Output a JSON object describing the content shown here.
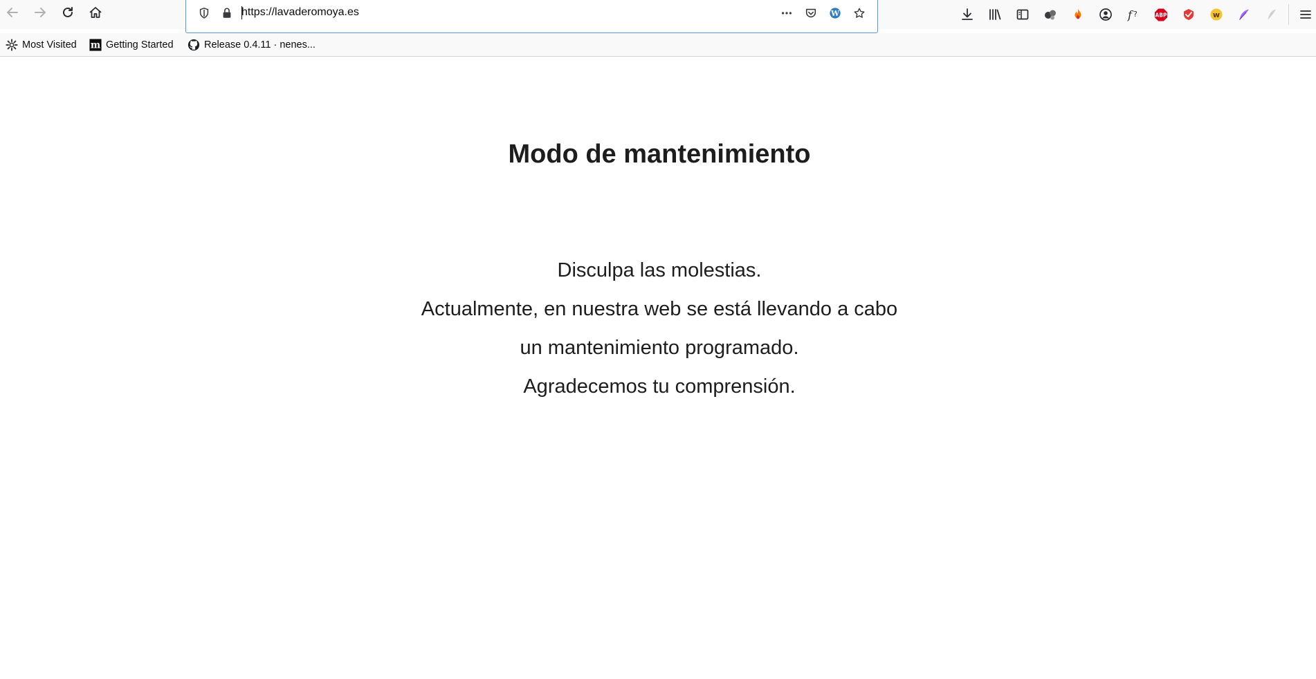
{
  "browser": {
    "url": "https://lavaderomoya.es",
    "nav_icons": [
      "back-arrow-icon",
      "forward-arrow-icon",
      "reload-icon",
      "home-icon"
    ],
    "url_icons": [
      "tracking-shield-icon",
      "lock-icon",
      "more-dots-icon",
      "pocket-icon",
      "wordpress-icon",
      "bookmark-star-icon"
    ],
    "toolbar_icons": [
      "download-icon",
      "library-icon",
      "sidebar-icon",
      "extension-balls-icon",
      "fire-extension-icon",
      "account-icon",
      "font-finder-icon",
      "adblock-plus-icon",
      "red-extension-icon",
      "yellow-w-extension-icon",
      "feather-icon",
      "grey-feather-icon",
      "hamburger-menu-icon"
    ],
    "colors": {
      "urlbar_focus": "#5b9bd5",
      "abp_red": "#d9001b",
      "toolbar_bg": "#f9f9fa"
    }
  },
  "bookmarks": [
    {
      "label": "Most Visited",
      "icon": "gear-icon"
    },
    {
      "label": "Getting Started",
      "icon": "m-logo-icon"
    },
    {
      "label": "Release 0.4.11 · nenes...",
      "icon": "github-icon"
    }
  ],
  "page": {
    "title": "Modo de mantenimiento",
    "lines": [
      "Disculpa las molestias.",
      "Actualmente, en nuestra web se está llevando a cabo",
      "un mantenimiento programado.",
      "Agradecemos tu comprensión."
    ]
  }
}
